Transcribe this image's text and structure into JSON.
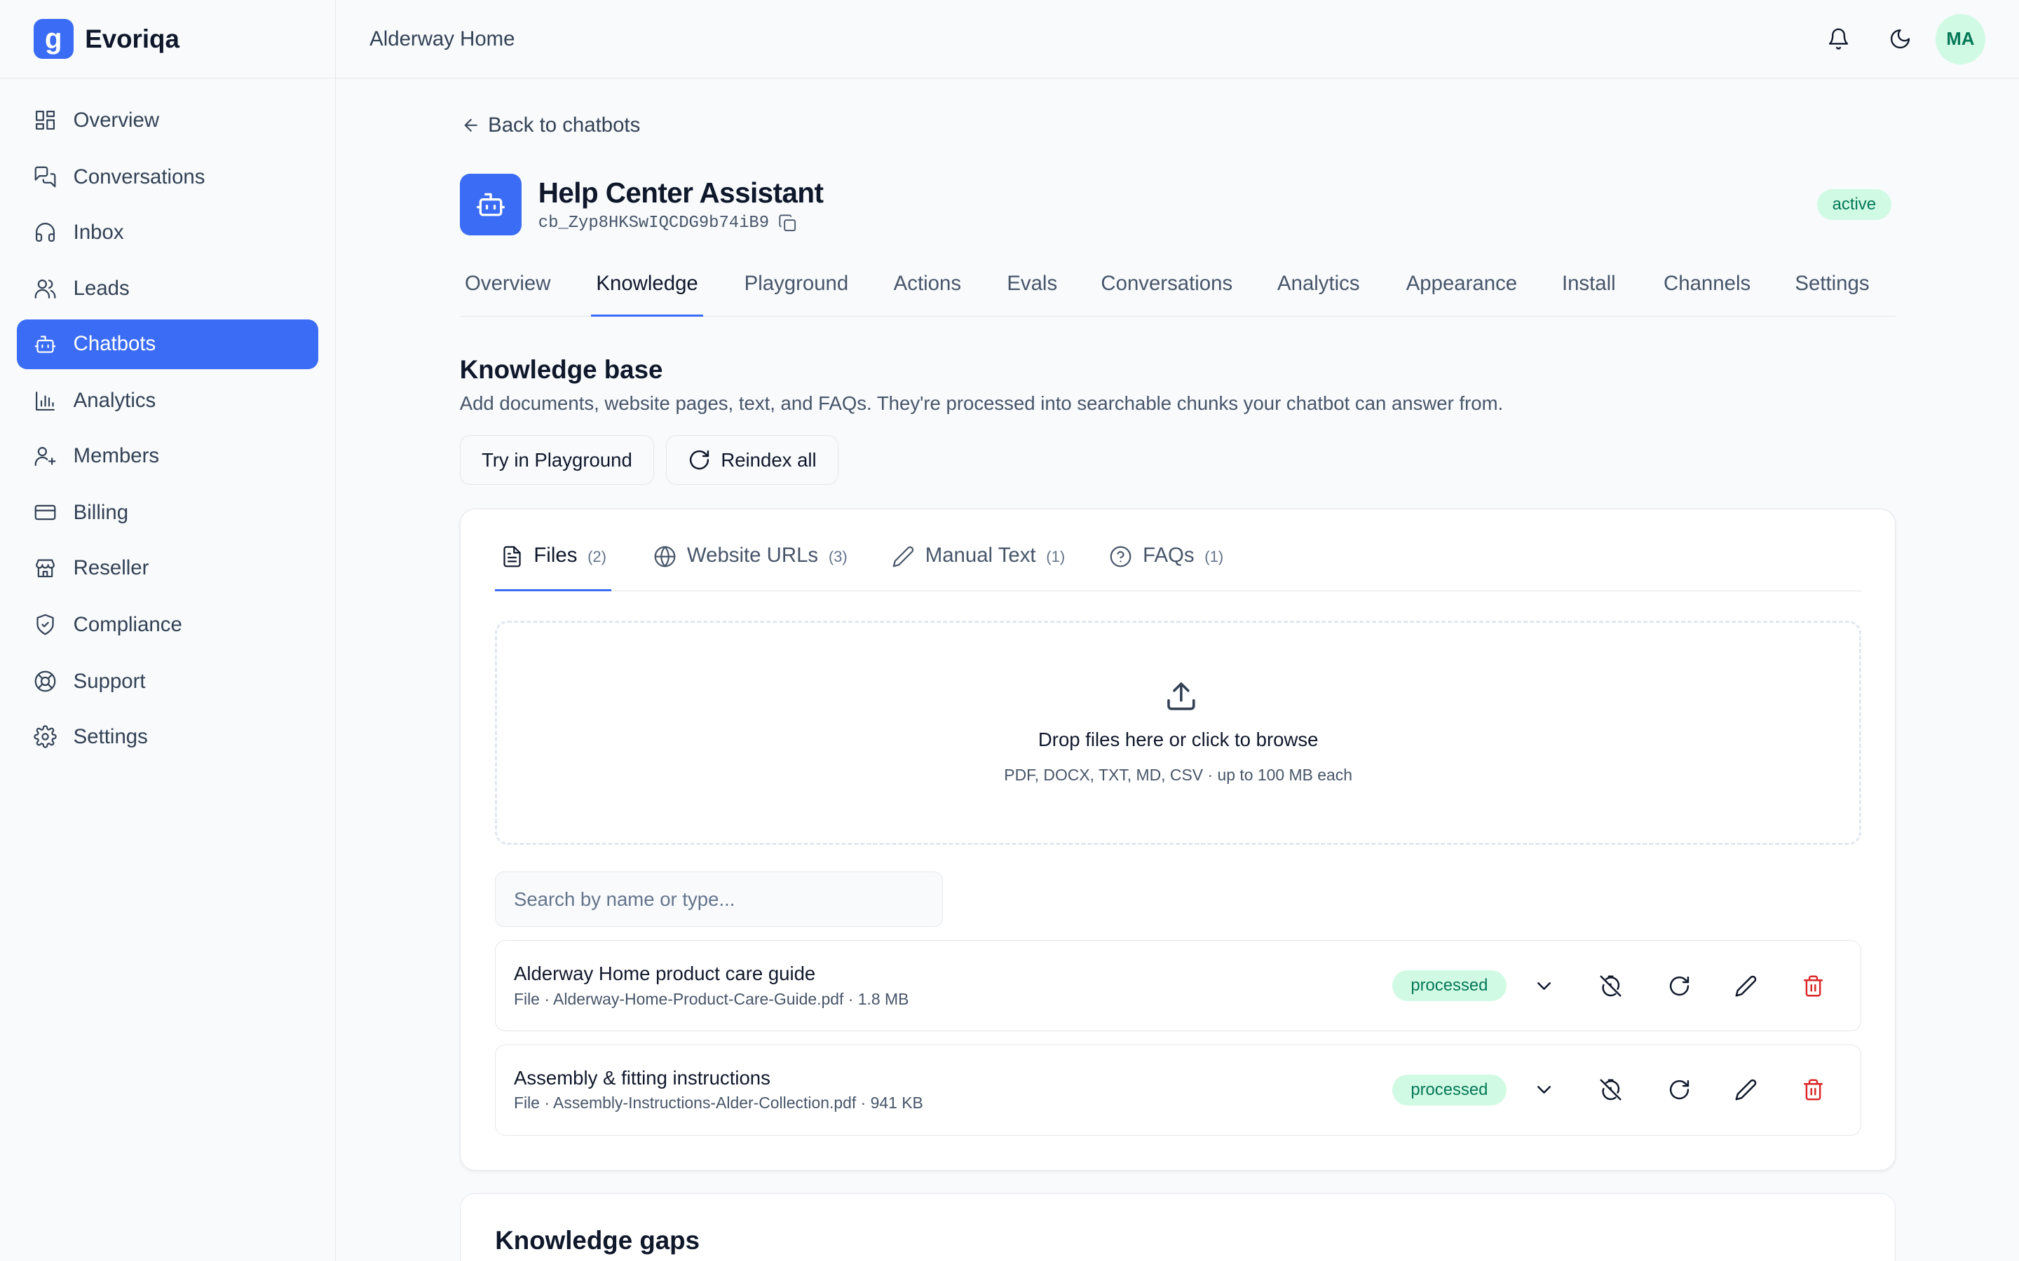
{
  "app": {
    "name": "Evoriqa",
    "logo_letter": "g"
  },
  "sidebar": {
    "items": [
      {
        "label": "Overview",
        "icon": "layout-dashboard-icon"
      },
      {
        "label": "Conversations",
        "icon": "messages-icon"
      },
      {
        "label": "Inbox",
        "icon": "headset-icon"
      },
      {
        "label": "Leads",
        "icon": "users-icon"
      },
      {
        "label": "Chatbots",
        "icon": "bot-icon",
        "active": true
      },
      {
        "label": "Analytics",
        "icon": "bar-chart-icon"
      },
      {
        "label": "Members",
        "icon": "user-plus-icon"
      },
      {
        "label": "Billing",
        "icon": "credit-card-icon"
      },
      {
        "label": "Reseller",
        "icon": "store-icon"
      },
      {
        "label": "Compliance",
        "icon": "shield-check-icon"
      },
      {
        "label": "Support",
        "icon": "life-buoy-icon"
      },
      {
        "label": "Settings",
        "icon": "gear-icon"
      }
    ]
  },
  "header": {
    "workspace": "Alderway Home",
    "avatar_initials": "MA"
  },
  "back_link": "Back to chatbots",
  "chatbot": {
    "name": "Help Center Assistant",
    "id": "cb_Zyp8HKSwIQCDG9b74iB9",
    "status": "active"
  },
  "tabs": [
    "Overview",
    "Knowledge",
    "Playground",
    "Actions",
    "Evals",
    "Conversations",
    "Analytics",
    "Appearance",
    "Install",
    "Channels",
    "Settings"
  ],
  "active_tab": "Knowledge",
  "knowledge": {
    "title": "Knowledge base",
    "description": "Add documents, website pages, text, and FAQs. They're processed into searchable chunks your chatbot can answer from.",
    "try_button": "Try in Playground",
    "reindex_button": "Reindex all",
    "subtabs": [
      {
        "label": "Files",
        "count": "(2)"
      },
      {
        "label": "Website URLs",
        "count": "(3)"
      },
      {
        "label": "Manual Text",
        "count": "(1)"
      },
      {
        "label": "FAQs",
        "count": "(1)"
      }
    ],
    "dropzone": {
      "title": "Drop files here or click to browse",
      "subtitle": "PDF, DOCX, TXT, MD, CSV · up to 100 MB each"
    },
    "search_placeholder": "Search by name or type...",
    "files": [
      {
        "name": "Alderway Home product care guide",
        "meta": "File · Alderway-Home-Product-Care-Guide.pdf · 1.8 MB",
        "status": "processed"
      },
      {
        "name": "Assembly & fitting instructions",
        "meta": "File · Assembly-Instructions-Alder-Collection.pdf · 941 KB",
        "status": "processed"
      }
    ]
  },
  "gaps": {
    "title": "Knowledge gaps"
  },
  "colors": {
    "accent": "#3b6cf6",
    "success_bg": "#d1fae5",
    "success_text": "#047857",
    "danger": "#dc2626"
  }
}
